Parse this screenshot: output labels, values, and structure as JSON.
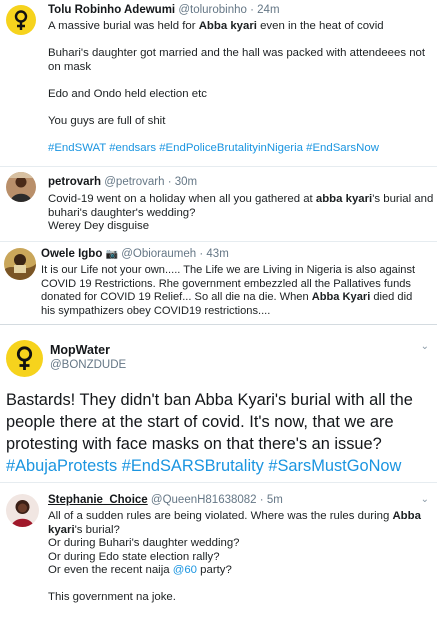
{
  "tweets": [
    {
      "name": "Tolu Robinho Adewumi",
      "handle": "@tolurobinho",
      "time": "· 24m",
      "lines": [
        [
          "A massive burial was held for ",
          {
            "b": "Abba kyari"
          },
          " even in the heat of covid"
        ],
        [
          "Buhari's daughter got married and the hall was packed with attendeees not",
          "on mask"
        ],
        [
          "Edo and Ondo held election etc"
        ],
        [
          "You guys are full of shit"
        ]
      ],
      "hashtags": "#EndSWAT #endsars #EndPoliceBrutalityinNigeria #EndSarsNow"
    },
    {
      "name": "petrovarh",
      "handle": "@petrovarh",
      "time": "· 30m",
      "line1a": "Covid-19 went on a holiday when all you gathered at ",
      "line1b": "abba kyari",
      "line1c": "'s burial and",
      "line2": "buhari's  daughter's wedding?",
      "line3": "Werey Dey disguise"
    },
    {
      "name": "Owele Igbo",
      "handle": "@Obioraumeh",
      "time": "· 43m",
      "l1": "It is our Life not your own..... The Life we are Living in Nigeria is also against",
      "l2": "COVID 19 Restrictions. Rhe government embezzled all the Pallatives funds",
      "l3": "donated for COVID 19 Relief... So all die na die. When ",
      "l3b": "Abba Kyari",
      "l3c": " died did",
      "l4": "his sympathizers obey COVID19 restrictions...."
    },
    {
      "name": "MopWater",
      "handle": "@BONZDUDE",
      "l1": "Bastards! They didn't ban Abba Kyari's burial with all the",
      "l2": "people there at the start of covid. It's now, that we are",
      "l3": "protesting with face masks on that there's an issue?",
      "tags": "#AbujaProtests #EndSARSBrutality #SarsMustGoNow"
    },
    {
      "name": "Stephanie_Choice",
      "handle": "@QueenH81638082",
      "time": "· 5m",
      "l1a": "All of a sudden rules are being violated. Where was the rules during ",
      "l1b": "Abba",
      "l2b": "kyari",
      "l2c": "'s burial?",
      "l3": "Or during Buhari's daughter wedding?",
      "l4": "Or during Edo state election rally?",
      "l5a": "Or even the recent naija ",
      "l5b": "@60",
      "l5c": " party?",
      "l6": "This government na joke."
    }
  ],
  "colors": {
    "link": "#1b95e0",
    "separator": "#e6ecf0",
    "feminist_bg": "#f6d31d"
  },
  "icons": [
    "feminist-symbol-icon",
    "user-photo",
    "chevron-down-icon",
    "emoji-icon"
  ]
}
